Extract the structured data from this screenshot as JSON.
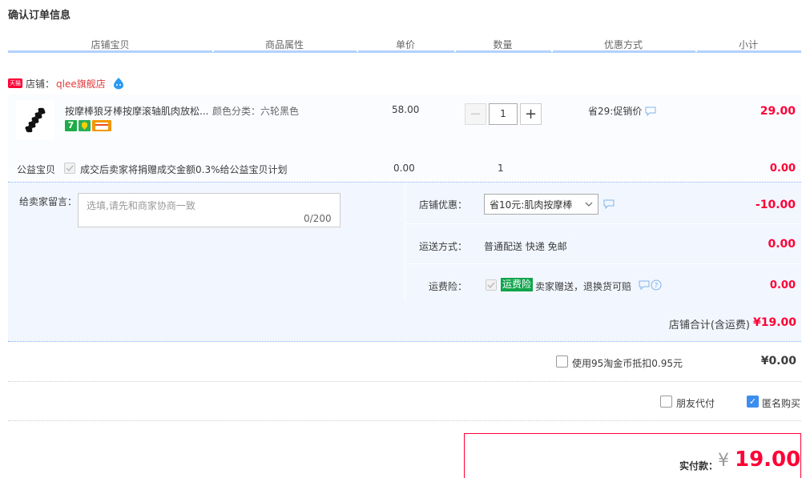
{
  "page": {
    "title": "确认订单信息"
  },
  "table_headers": [
    "店铺宝贝",
    "商品属性",
    "单价",
    "数量",
    "优惠方式",
    "小计"
  ],
  "shop": {
    "tmall_badge": "天猫",
    "label": "店铺：",
    "name": "qlee旗舰店"
  },
  "item": {
    "title": "按摩棒狼牙棒按摩滚轴肌肉放松...",
    "attribute": "颜色分类：六轮黑色",
    "unit_price": "58.00",
    "quantity": "1",
    "promo": "省29:促销价",
    "subtotal": "29.00",
    "badge_7": "7"
  },
  "charity": {
    "label": "公益宝贝",
    "text": "成交后卖家将捐赠成交金额0.3%给公益宝贝计划",
    "price": "0.00",
    "quantity": "1",
    "subtotal": "0.00"
  },
  "message": {
    "label": "给卖家留言：",
    "placeholder": "选填,请先和商家协商一致",
    "count": "0/200"
  },
  "shop_discount": {
    "label": "店铺优惠：",
    "selected": "省10元:肌肉按摩棒",
    "amount": "-10.00"
  },
  "shipping": {
    "label": "运送方式：",
    "text": "普通配送 快递 免邮",
    "amount": "0.00"
  },
  "insurance": {
    "label": "运费险：",
    "tag": "运费险",
    "text": "卖家赠送，退换货可赔",
    "amount": "0.00"
  },
  "shop_total": {
    "label": "店铺合计(含运费)",
    "value": "¥19.00"
  },
  "coins": {
    "label": "使用95淘金币抵扣0.95元",
    "value": "¥0.00"
  },
  "options": {
    "friend_pay": "朋友代付",
    "anonymous": "匿名购买",
    "anonymous_checked": true
  },
  "payment": {
    "label": "实付款：",
    "yen": "¥",
    "value": "19.00"
  },
  "colors": {
    "accent_red": "#ff0036",
    "header_rule": "#b2d1ff",
    "panel_bg": "#f2f7ff",
    "insurance_green": "#10a54d"
  }
}
